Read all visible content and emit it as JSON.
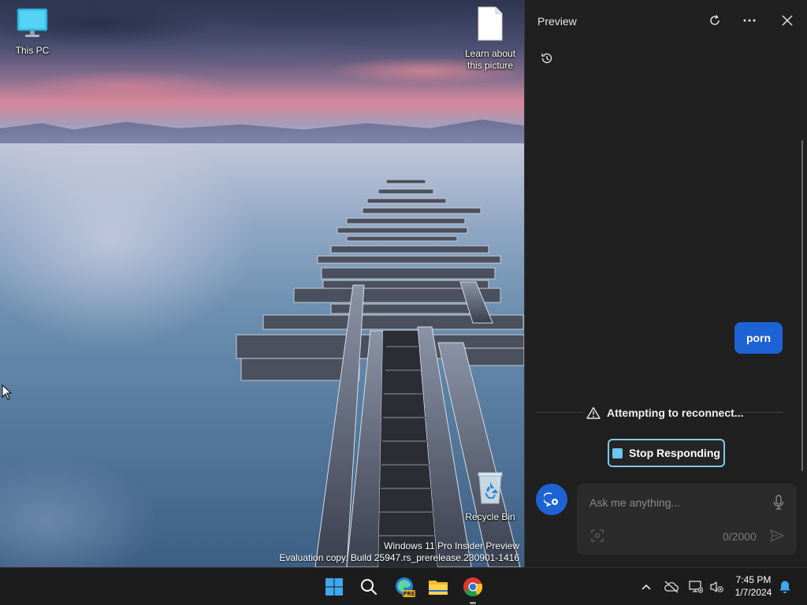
{
  "desktop": {
    "icons": [
      {
        "label": "This PC"
      },
      {
        "label": "Learn about this picture"
      },
      {
        "label": "Recycle Bin"
      }
    ],
    "watermark": {
      "line1": "Windows 11 Pro Insider Preview",
      "line2": "Evaluation copy. Build 25947.rs_prerelease.230901-1416"
    }
  },
  "copilot": {
    "title": "Preview",
    "user_message": "porn",
    "status_text": "Attempting to reconnect...",
    "stop_button": "Stop Responding",
    "input_placeholder": "Ask me anything...",
    "char_count": "0/2000",
    "accent_color": "#1e63d6"
  },
  "taskbar": {
    "apps": [
      "start-icon",
      "search-icon",
      "edge-beta-icon",
      "file-explorer-icon",
      "chrome-icon"
    ],
    "edge_badge": "PRE",
    "clock": {
      "time": "7:45 PM",
      "date": "1/7/2024"
    }
  }
}
